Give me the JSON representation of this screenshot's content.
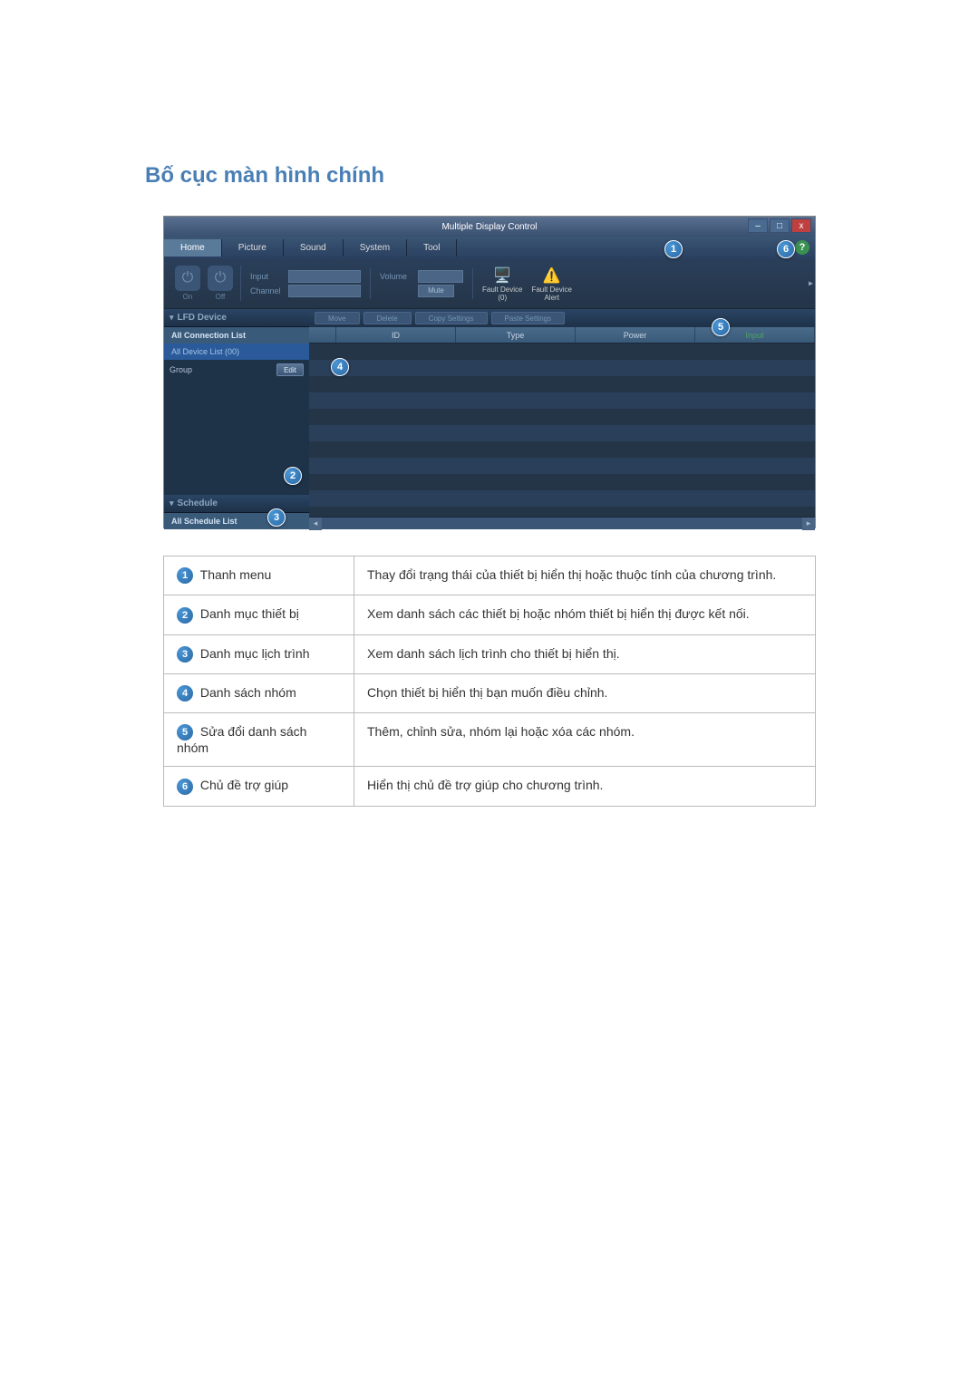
{
  "page_title": "Bố cục màn hình chính",
  "window": {
    "title": "Multiple Display Control",
    "min": "–",
    "max": "□",
    "close": "x"
  },
  "menu": {
    "home": "Home",
    "picture": "Picture",
    "sound": "Sound",
    "system": "System",
    "tool": "Tool"
  },
  "help": "?",
  "toolbar": {
    "on": "On",
    "off": "Off",
    "input": "Input",
    "channel": "Channel",
    "volume": "Volume",
    "mute": "Mute",
    "fault_device": "Fault Device\n(0)",
    "fault_alert": "Fault Device\nAlert",
    "arrow": "▸"
  },
  "sidebar": {
    "lfd_device": "LFD Device",
    "all_connection": "All Connection List",
    "all_device_list": "All Device List (00)",
    "group": "Group",
    "edit": "Edit",
    "schedule": "Schedule",
    "all_schedule": "All Schedule List"
  },
  "actions": {
    "move": "Move",
    "delete": "Delete",
    "copy": "Copy Settings",
    "paste": "Paste Settings"
  },
  "columns": {
    "id": "ID",
    "type": "Type",
    "power": "Power",
    "input": "Input"
  },
  "callouts": {
    "1": "1",
    "2": "2",
    "3": "3",
    "4": "4",
    "5": "5",
    "6": "6"
  },
  "legend": [
    {
      "num": "1",
      "label": "Thanh menu",
      "desc": "Thay đổi trạng thái của thiết bị hiển thị hoặc thuộc tính của chương trình."
    },
    {
      "num": "2",
      "label": "Danh mục thiết bị",
      "desc": "Xem danh sách các thiết bị hoặc nhóm thiết bị hiển thị được kết nối."
    },
    {
      "num": "3",
      "label": "Danh mục lịch trình",
      "desc": "Xem danh sách lịch trình cho thiết bị hiển thị."
    },
    {
      "num": "4",
      "label": "Danh sách nhóm",
      "desc": "Chọn thiết bị hiển thị bạn muốn điều chỉnh."
    },
    {
      "num": "5",
      "label": "Sửa đổi danh sách nhóm",
      "desc": "Thêm, chỉnh sửa, nhóm lại hoặc xóa các nhóm."
    },
    {
      "num": "6",
      "label": "Chủ đề trợ giúp",
      "desc": "Hiển thị chủ đề trợ giúp cho chương trình."
    }
  ]
}
